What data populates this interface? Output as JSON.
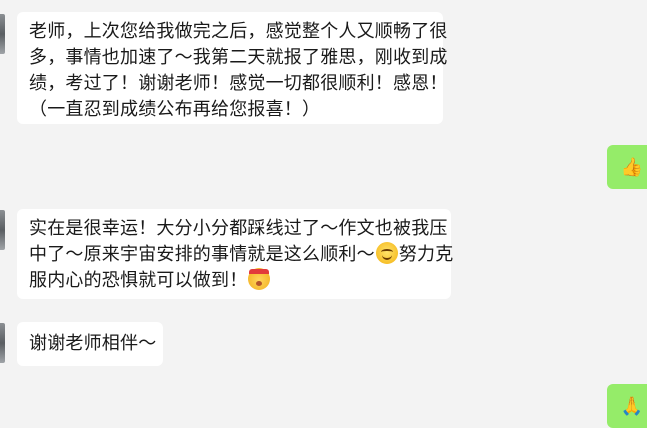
{
  "messages": [
    {
      "lines": [
        "老师，上次您给我做完之后，感觉整个人又顺畅了很",
        "多，事情也加速了～我第二天就报了雅思，刚收到成",
        "绩，考过了！谢谢老师！感觉一切都很顺利！感恩！",
        "（一直忍到成绩公布再给您报喜！）"
      ]
    },
    {
      "emoji": "👍"
    },
    {
      "line1": "实在是很幸运！大分小分都踩线过了～作文也被我压",
      "line2_text": "中了～原来宇宙安排的事情就是这么顺利～",
      "line2_emoji": "smiling-face-icon",
      "line2_tail": "努力克",
      "line3_text": "服内心的恐惧就可以做到！",
      "line3_emoji": "determined-face-icon"
    },
    {
      "text": "谢谢老师相伴～"
    },
    {
      "emoji": "🙏"
    }
  ],
  "colors": {
    "background": "#f3f3f3",
    "incoming_bubble": "#ffffff",
    "outgoing_bubble": "#95ec69"
  }
}
